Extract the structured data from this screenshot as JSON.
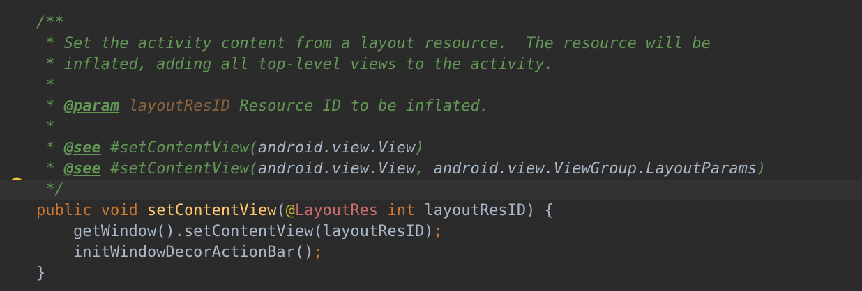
{
  "editor": {
    "lines": [
      {
        "kind": "doc",
        "segments": [
          {
            "cls": "doc",
            "t": "/**"
          }
        ]
      },
      {
        "kind": "doc",
        "segments": [
          {
            "cls": "doc",
            "t": " * Set the activity content from a layout resource.  The resource will be"
          }
        ]
      },
      {
        "kind": "doc",
        "segments": [
          {
            "cls": "doc",
            "t": " * inflated, adding all top-level views to the activity."
          }
        ]
      },
      {
        "kind": "doc",
        "segments": [
          {
            "cls": "doc",
            "t": " *"
          }
        ]
      },
      {
        "kind": "doc",
        "segments": [
          {
            "cls": "doc",
            "t": " * "
          },
          {
            "cls": "tag",
            "t": "@param"
          },
          {
            "cls": "doc",
            "t": " "
          },
          {
            "cls": "pname",
            "t": "layoutResID"
          },
          {
            "cls": "doc",
            "t": " Resource ID to be inflated."
          }
        ]
      },
      {
        "kind": "doc",
        "segments": [
          {
            "cls": "doc",
            "t": " *"
          }
        ]
      },
      {
        "kind": "doc",
        "segments": [
          {
            "cls": "doc",
            "t": " * "
          },
          {
            "cls": "tag",
            "t": "@see"
          },
          {
            "cls": "doc",
            "t": " #setContentView("
          },
          {
            "cls": "ref",
            "t": "android.view.View"
          },
          {
            "cls": "doc",
            "t": ")"
          }
        ]
      },
      {
        "kind": "doc",
        "segments": [
          {
            "cls": "doc",
            "t": " * "
          },
          {
            "cls": "tag",
            "t": "@see"
          },
          {
            "cls": "doc",
            "t": " #setContentView("
          },
          {
            "cls": "ref",
            "t": "android.view.View"
          },
          {
            "cls": "doc",
            "t": ", "
          },
          {
            "cls": "ref",
            "t": "android.view.ViewGroup.LayoutParams"
          },
          {
            "cls": "doc",
            "t": ")"
          }
        ]
      },
      {
        "kind": "doc",
        "current": true,
        "segments": [
          {
            "cls": "doc",
            "t": " */"
          }
        ]
      },
      {
        "kind": "code",
        "segments": [
          {
            "cls": "kw",
            "t": "public"
          },
          {
            "cls": "plain",
            "t": " "
          },
          {
            "cls": "kw",
            "t": "void"
          },
          {
            "cls": "plain",
            "t": " "
          },
          {
            "cls": "fn",
            "t": "setContentView"
          },
          {
            "cls": "plain",
            "t": "("
          },
          {
            "cls": "anno",
            "t": "@"
          },
          {
            "cls": "annoname",
            "t": "LayoutRes"
          },
          {
            "cls": "plain",
            "t": " "
          },
          {
            "cls": "kw",
            "t": "int"
          },
          {
            "cls": "plain",
            "t": " layoutResID) {"
          }
        ]
      },
      {
        "kind": "code",
        "segments": [
          {
            "cls": "plain",
            "t": "    getWindow().setContentView(layoutResID)"
          },
          {
            "cls": "punc",
            "t": ";"
          }
        ]
      },
      {
        "kind": "code",
        "segments": [
          {
            "cls": "plain",
            "t": "    initWindowDecorActionBar()"
          },
          {
            "cls": "punc",
            "t": ";"
          }
        ]
      },
      {
        "kind": "code",
        "segments": [
          {
            "cls": "plain",
            "t": "}"
          }
        ]
      }
    ]
  },
  "gutter": {
    "intention_icon": "lightbulb-icon"
  },
  "colors": {
    "background": "#2b2b2b",
    "current_line": "#323232",
    "doc_comment": "#629755",
    "keyword": "#cc7832",
    "method": "#ffc66d",
    "annotation": "#bbb529",
    "param_name": "#8a653b",
    "text": "#a9b7c6"
  }
}
